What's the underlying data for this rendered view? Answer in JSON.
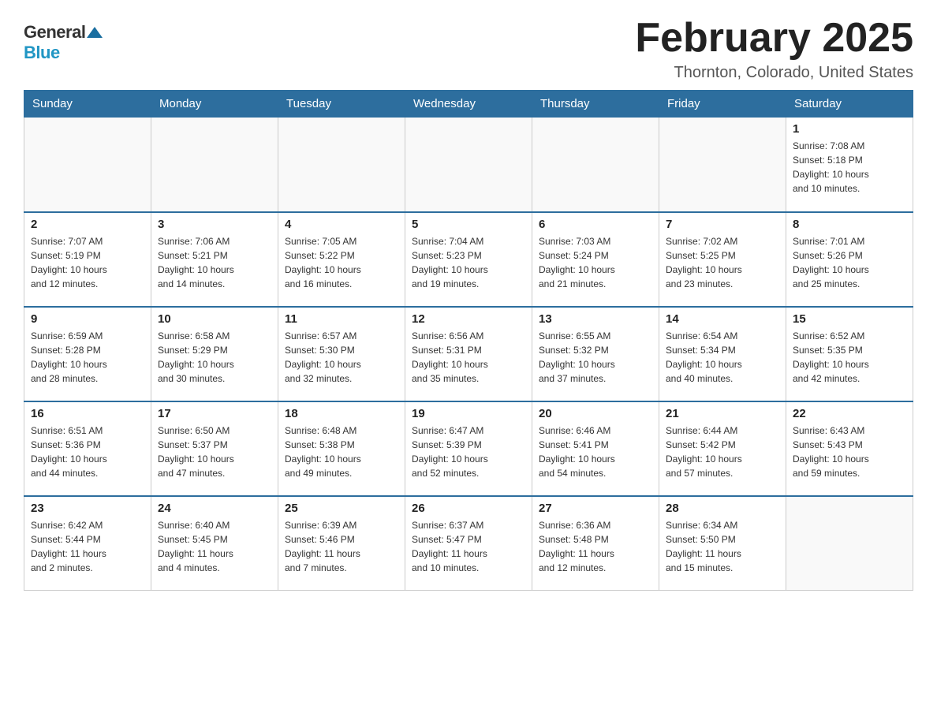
{
  "logo": {
    "general": "General",
    "blue": "Blue"
  },
  "title": "February 2025",
  "location": "Thornton, Colorado, United States",
  "weekdays": [
    "Sunday",
    "Monday",
    "Tuesday",
    "Wednesday",
    "Thursday",
    "Friday",
    "Saturday"
  ],
  "weeks": [
    [
      {
        "day": "",
        "info": ""
      },
      {
        "day": "",
        "info": ""
      },
      {
        "day": "",
        "info": ""
      },
      {
        "day": "",
        "info": ""
      },
      {
        "day": "",
        "info": ""
      },
      {
        "day": "",
        "info": ""
      },
      {
        "day": "1",
        "info": "Sunrise: 7:08 AM\nSunset: 5:18 PM\nDaylight: 10 hours\nand 10 minutes."
      }
    ],
    [
      {
        "day": "2",
        "info": "Sunrise: 7:07 AM\nSunset: 5:19 PM\nDaylight: 10 hours\nand 12 minutes."
      },
      {
        "day": "3",
        "info": "Sunrise: 7:06 AM\nSunset: 5:21 PM\nDaylight: 10 hours\nand 14 minutes."
      },
      {
        "day": "4",
        "info": "Sunrise: 7:05 AM\nSunset: 5:22 PM\nDaylight: 10 hours\nand 16 minutes."
      },
      {
        "day": "5",
        "info": "Sunrise: 7:04 AM\nSunset: 5:23 PM\nDaylight: 10 hours\nand 19 minutes."
      },
      {
        "day": "6",
        "info": "Sunrise: 7:03 AM\nSunset: 5:24 PM\nDaylight: 10 hours\nand 21 minutes."
      },
      {
        "day": "7",
        "info": "Sunrise: 7:02 AM\nSunset: 5:25 PM\nDaylight: 10 hours\nand 23 minutes."
      },
      {
        "day": "8",
        "info": "Sunrise: 7:01 AM\nSunset: 5:26 PM\nDaylight: 10 hours\nand 25 minutes."
      }
    ],
    [
      {
        "day": "9",
        "info": "Sunrise: 6:59 AM\nSunset: 5:28 PM\nDaylight: 10 hours\nand 28 minutes."
      },
      {
        "day": "10",
        "info": "Sunrise: 6:58 AM\nSunset: 5:29 PM\nDaylight: 10 hours\nand 30 minutes."
      },
      {
        "day": "11",
        "info": "Sunrise: 6:57 AM\nSunset: 5:30 PM\nDaylight: 10 hours\nand 32 minutes."
      },
      {
        "day": "12",
        "info": "Sunrise: 6:56 AM\nSunset: 5:31 PM\nDaylight: 10 hours\nand 35 minutes."
      },
      {
        "day": "13",
        "info": "Sunrise: 6:55 AM\nSunset: 5:32 PM\nDaylight: 10 hours\nand 37 minutes."
      },
      {
        "day": "14",
        "info": "Sunrise: 6:54 AM\nSunset: 5:34 PM\nDaylight: 10 hours\nand 40 minutes."
      },
      {
        "day": "15",
        "info": "Sunrise: 6:52 AM\nSunset: 5:35 PM\nDaylight: 10 hours\nand 42 minutes."
      }
    ],
    [
      {
        "day": "16",
        "info": "Sunrise: 6:51 AM\nSunset: 5:36 PM\nDaylight: 10 hours\nand 44 minutes."
      },
      {
        "day": "17",
        "info": "Sunrise: 6:50 AM\nSunset: 5:37 PM\nDaylight: 10 hours\nand 47 minutes."
      },
      {
        "day": "18",
        "info": "Sunrise: 6:48 AM\nSunset: 5:38 PM\nDaylight: 10 hours\nand 49 minutes."
      },
      {
        "day": "19",
        "info": "Sunrise: 6:47 AM\nSunset: 5:39 PM\nDaylight: 10 hours\nand 52 minutes."
      },
      {
        "day": "20",
        "info": "Sunrise: 6:46 AM\nSunset: 5:41 PM\nDaylight: 10 hours\nand 54 minutes."
      },
      {
        "day": "21",
        "info": "Sunrise: 6:44 AM\nSunset: 5:42 PM\nDaylight: 10 hours\nand 57 minutes."
      },
      {
        "day": "22",
        "info": "Sunrise: 6:43 AM\nSunset: 5:43 PM\nDaylight: 10 hours\nand 59 minutes."
      }
    ],
    [
      {
        "day": "23",
        "info": "Sunrise: 6:42 AM\nSunset: 5:44 PM\nDaylight: 11 hours\nand 2 minutes."
      },
      {
        "day": "24",
        "info": "Sunrise: 6:40 AM\nSunset: 5:45 PM\nDaylight: 11 hours\nand 4 minutes."
      },
      {
        "day": "25",
        "info": "Sunrise: 6:39 AM\nSunset: 5:46 PM\nDaylight: 11 hours\nand 7 minutes."
      },
      {
        "day": "26",
        "info": "Sunrise: 6:37 AM\nSunset: 5:47 PM\nDaylight: 11 hours\nand 10 minutes."
      },
      {
        "day": "27",
        "info": "Sunrise: 6:36 AM\nSunset: 5:48 PM\nDaylight: 11 hours\nand 12 minutes."
      },
      {
        "day": "28",
        "info": "Sunrise: 6:34 AM\nSunset: 5:50 PM\nDaylight: 11 hours\nand 15 minutes."
      },
      {
        "day": "",
        "info": ""
      }
    ]
  ]
}
